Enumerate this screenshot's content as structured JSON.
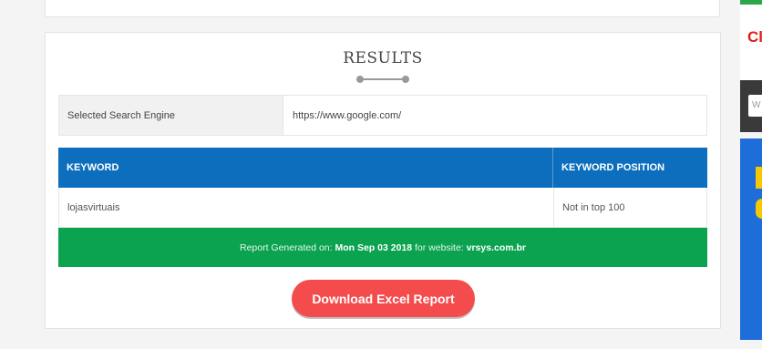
{
  "results": {
    "heading": "RESULTS"
  },
  "engine": {
    "label": "Selected Search Engine",
    "value": "https://www.google.com/"
  },
  "keywords_table": {
    "headers": [
      "KEYWORD",
      "KEYWORD POSITION"
    ],
    "rows": [
      [
        "lojasvirtuais",
        "Not in top 100"
      ]
    ]
  },
  "report": {
    "prefix": "Report Generated on: ",
    "date": "Mon Sep 03 2018",
    "middle": " for website: ",
    "website": "vrsys.com.br"
  },
  "actions": {
    "download_label": "Download Excel Report"
  },
  "sidebar": {
    "promo_text": "Cl",
    "input_placeholder": "W"
  },
  "colors": {
    "header_blue": "#0c6ebd",
    "report_green": "#0ba350",
    "button_red": "#f44c4c"
  }
}
